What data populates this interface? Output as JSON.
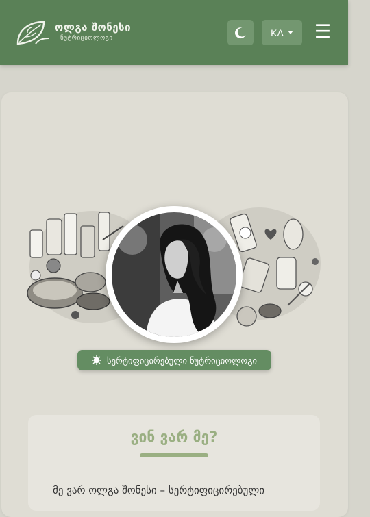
{
  "header": {
    "logo_title": "ოლგა შონესი",
    "logo_subtitle": "ნუტრიციოლოგი",
    "theme_icon": "moon-icon",
    "language": "KA",
    "menu_icon": "☰"
  },
  "hero": {
    "badge_icon": "sun-icon",
    "badge_text": "სერტიფიცირებული ნუტრიციოლოგი"
  },
  "about": {
    "title": "ვინ ვარ მე?",
    "intro": "მე ვარ ოლგა შონესი – სერტიფიცირებული"
  },
  "colors": {
    "header_bg": "#5a8157",
    "accent": "#9aaf82",
    "badge_bg": "#648d62",
    "page_bg": "#d6d5cc"
  }
}
